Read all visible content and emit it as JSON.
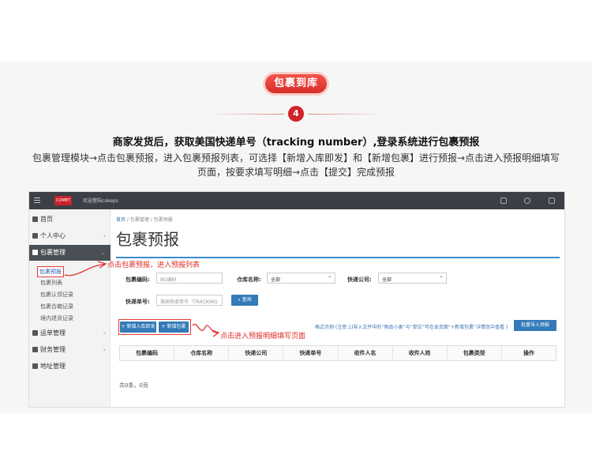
{
  "banner": {
    "badge": "包裹到库",
    "step_number": "4"
  },
  "headline": "商家发货后，获取美国快递单号（tracking number）,登录系统进行包裹预报",
  "description_lines": [
    "包裹管理模块→点击包裹预报，进入包裹预报列表，可选择【新增入库即发】和【新增包裹】进行预报→点击进入预报明细填写",
    "页面，按要求填写明细→点击【提交】完成预报"
  ],
  "topbar": {
    "logo_text": "COMET",
    "welcome_text": "欢迎登陆cokeps"
  },
  "sidebar": {
    "items": [
      {
        "label": "首页",
        "icon": "home-icon"
      },
      {
        "label": "个人中心",
        "icon": "user-icon"
      },
      {
        "label": "包裹管理",
        "icon": "package-icon"
      },
      {
        "label": "运单管理",
        "icon": "list-icon"
      },
      {
        "label": "财务管理",
        "icon": "dollar-icon"
      },
      {
        "label": "地址管理",
        "icon": "send-icon"
      }
    ],
    "subitems": [
      "包裹预报",
      "包裹列表",
      "包裹认领记录",
      "包裹合箱记录",
      "境内退货记录"
    ]
  },
  "breadcrumb": {
    "home": "首页",
    "section": "包裹管理",
    "page": "包裹预报"
  },
  "page_title": "包裹预报",
  "form": {
    "code_label": "包裹编码:",
    "code_placeholder": "BG编码",
    "warehouse_label": "仓库名称:",
    "warehouse_value": "全部",
    "courier_label": "快递公司:",
    "courier_value": "全部",
    "tracking_label": "快递单号:",
    "tracking_placeholder": "美国快递单号（TRACKING",
    "search_button": "查询"
  },
  "actions": {
    "add_instant": "+ 新增入库即发",
    "add_package": "+ 新增包裹",
    "format_note": "格式示例 (注意:1)导入文件中的“物品小类”与“单位”可在本页面“+新增包裹”详情页中查看 )",
    "import_button": "批量导入预报"
  },
  "table": {
    "headers": [
      "包裹编码",
      "仓库名称",
      "快递公司",
      "快递单号",
      "收件人名",
      "收件人姓",
      "包裹类型",
      "操作"
    ],
    "summary": "共0条，0页"
  },
  "annotations": {
    "first": "点击包裹预报，进入预报列表",
    "second": "点击进入预报明细填写页面"
  },
  "colors": {
    "accent_red": "#d2232a",
    "primary_blue": "#337ab7",
    "sidebar_active": "#4a4e55"
  }
}
